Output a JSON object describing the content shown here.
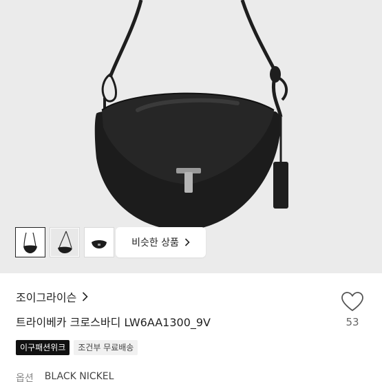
{
  "gallery": {
    "thumbnails": [
      {
        "name": "thumbnail-1"
      },
      {
        "name": "thumbnail-2"
      },
      {
        "name": "thumbnail-3"
      }
    ],
    "similar_button_label": "비슷한 상품",
    "similar_button_icon": "chevron-right-icon"
  },
  "product": {
    "brand": "조이그라이슨",
    "brand_icon": "chevron-right-icon",
    "title": "트라이베카 크로스바디 LW6AA1300_9V",
    "like_icon": "heart-icon",
    "like_count": "53",
    "badges": [
      {
        "label": "이구패션위크",
        "style": "dark"
      },
      {
        "label": "조건부 무료배송",
        "style": "light"
      }
    ],
    "option_label": "옵션",
    "option_value": "BLACK NICKEL"
  },
  "colors": {
    "hero_bg": "#ebebeb",
    "bag": "#1a1a1a",
    "badge_dark": "#111111"
  }
}
